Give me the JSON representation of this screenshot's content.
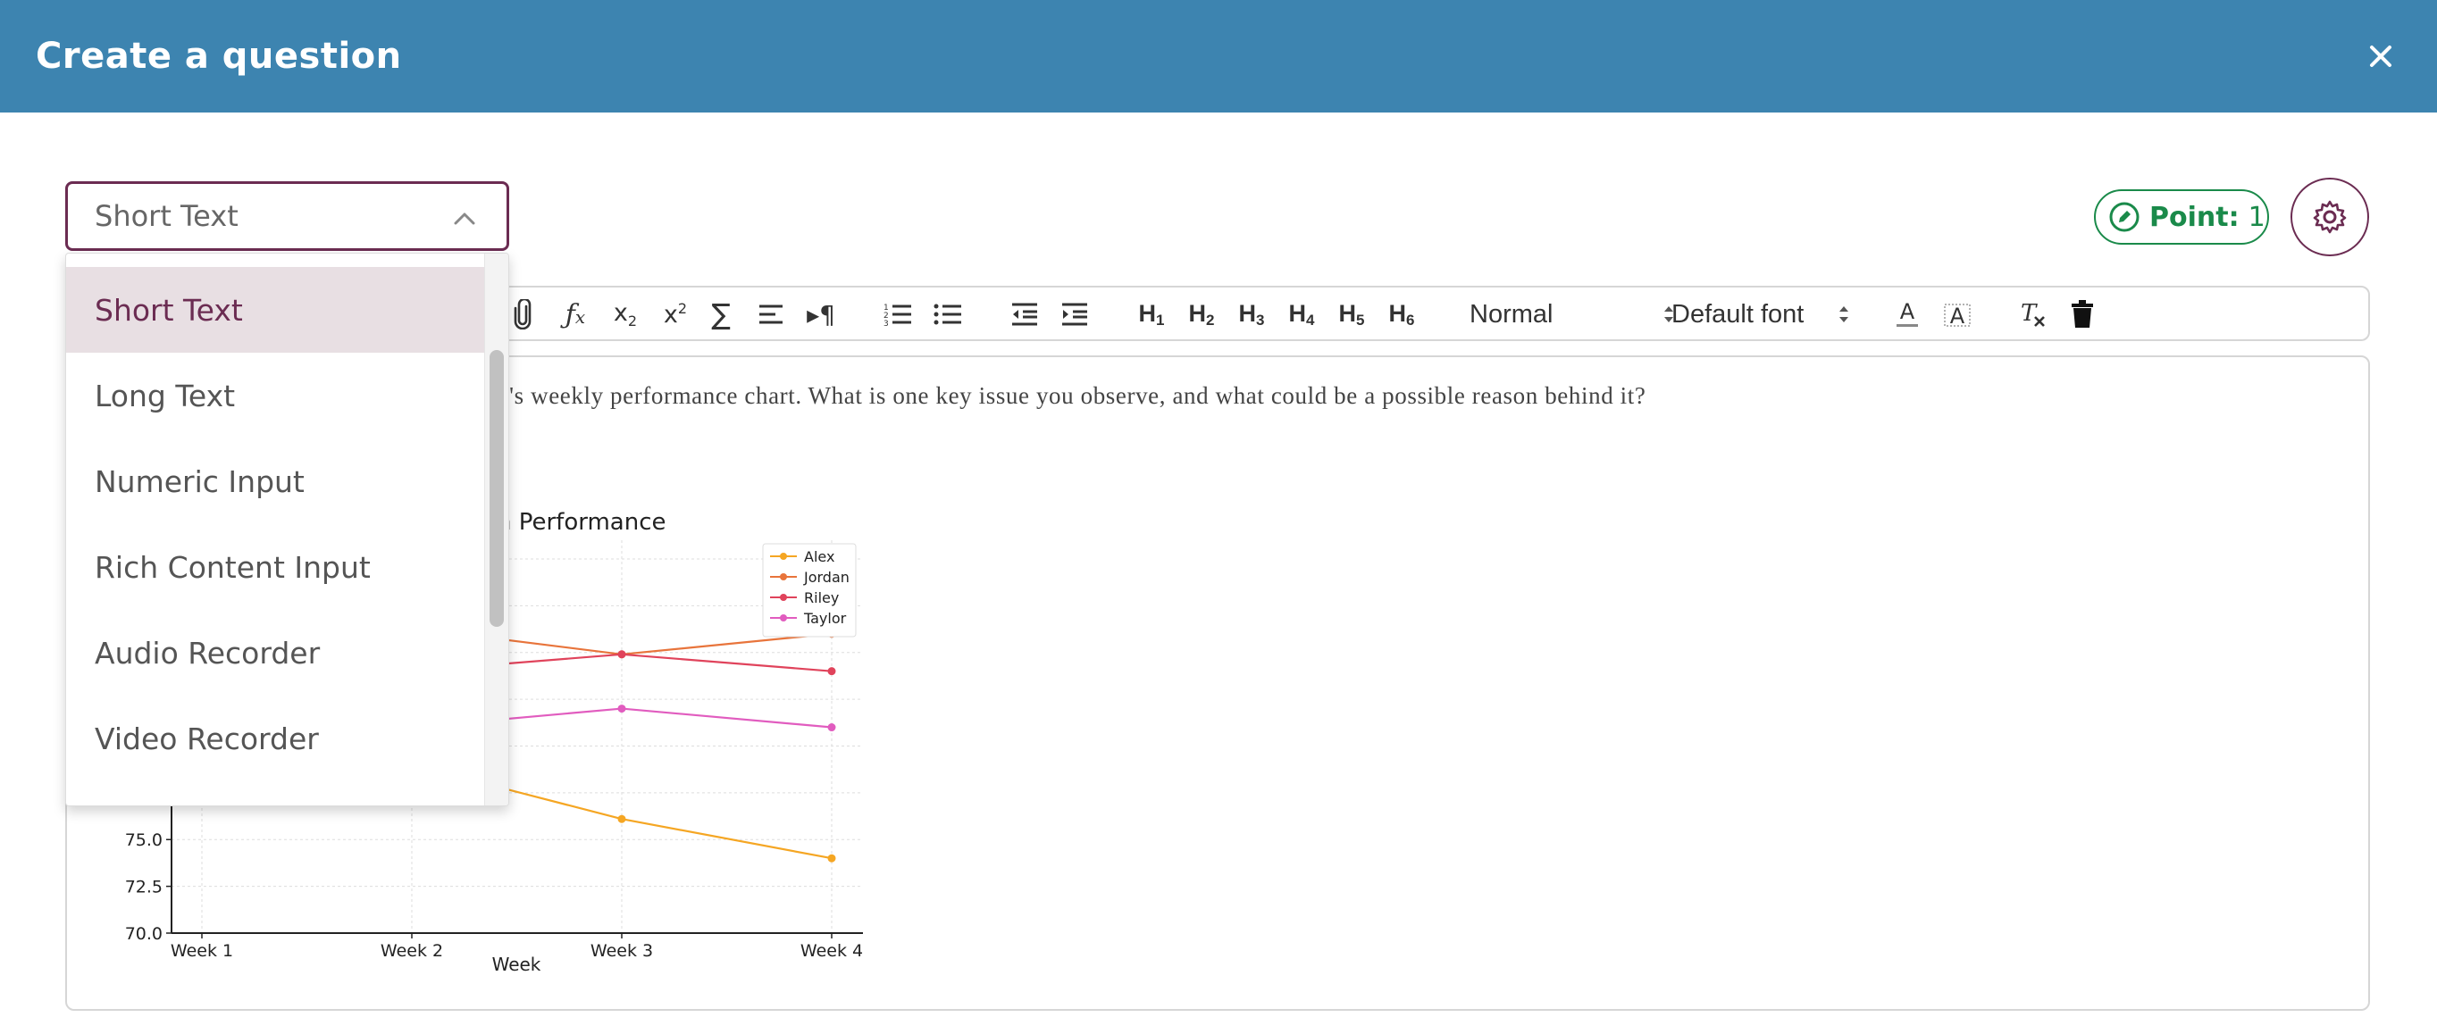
{
  "header": {
    "title": "Create a question"
  },
  "question_type": {
    "selected": "Short Text",
    "options": [
      "Short Text",
      "Long Text",
      "Numeric Input",
      "Rich Content Input",
      "Audio Recorder",
      "Video Recorder"
    ]
  },
  "points": {
    "label": "Point:",
    "value": "1"
  },
  "toolbar": {
    "text_style": "Normal",
    "font": "Default font"
  },
  "editor": {
    "question_text": "am's weekly performance chart. What is one key issue you observe, and what could be a possible reason behind it?"
  },
  "chart_data": {
    "type": "line",
    "title": "n Performance",
    "xlabel": "Week",
    "ylabel": "",
    "categories": [
      "Week 1",
      "Week 2",
      "Week 3",
      "Week 4"
    ],
    "ylim": [
      70.0,
      91.0
    ],
    "yticks": [
      "70.0",
      "72.5",
      "75.0"
    ],
    "legend": "top-right",
    "grid": true,
    "series": [
      {
        "name": "Alex",
        "color": "#f5a623",
        "values": [
          81.0,
          79.0,
          76.1,
          74.0
        ]
      },
      {
        "name": "Jordan",
        "color": "#e8743b",
        "values": [
          88.0,
          86.3,
          84.9,
          86.0
        ]
      },
      {
        "name": "Riley",
        "color": "#e0435b",
        "values": [
          83.0,
          84.0,
          84.9,
          84.0
        ]
      },
      {
        "name": "Taylor",
        "color": "#e15cbf",
        "values": [
          82.0,
          81.0,
          82.0,
          81.0
        ]
      }
    ]
  }
}
